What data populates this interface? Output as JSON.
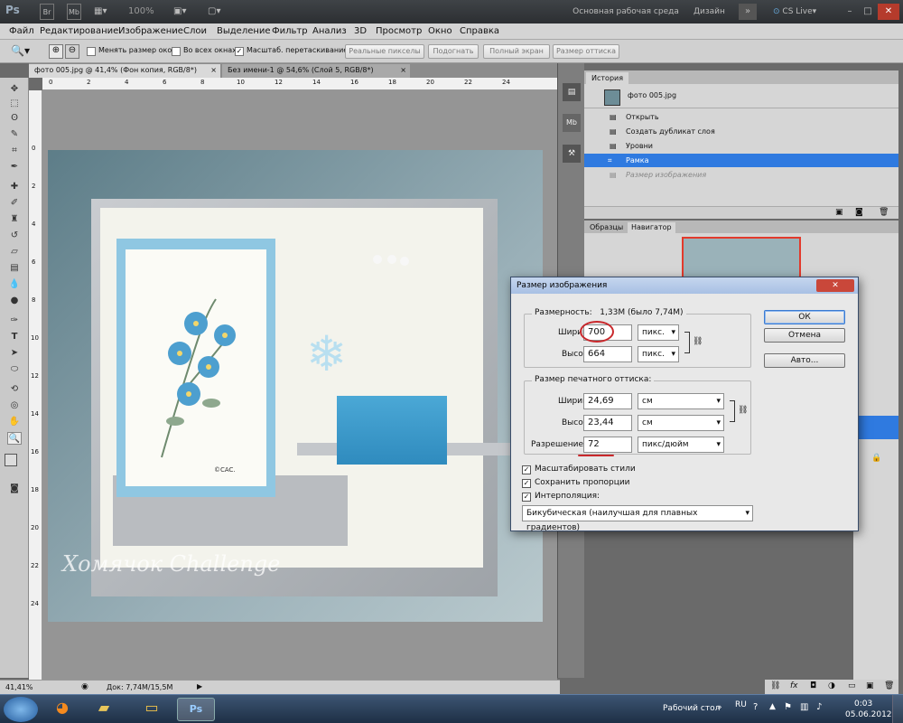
{
  "app": {
    "logo": "Ps",
    "zoom": "100%"
  },
  "workspace": {
    "basic": "Основная рабочая среда",
    "design": "Дизайн",
    "cs_live": "CS Live"
  },
  "menu": [
    "Файл",
    "Редактирование",
    "Изображение",
    "Слои",
    "Выделение",
    "Фильтр",
    "Анализ",
    "3D",
    "Просмотр",
    "Окно",
    "Справка"
  ],
  "options": {
    "resize_windows": "Менять размер окон",
    "all_windows": "Во всех окнах",
    "scrubby_zoom": "Масштаб. перетаскиванием",
    "actual_pixels": "Реальные пикселы",
    "fit": "Подогнать",
    "full_screen": "Полный экран",
    "print_size": "Размер оттиска"
  },
  "tabs": [
    {
      "label": "фото 005.jpg @ 41,4% (Фон копия, RGB/8*)",
      "close": "×"
    },
    {
      "label": "Без имени-1 @ 54,6% (Слой 5, RGB/8*)",
      "close": "×"
    }
  ],
  "ruler_ticks": [
    "0",
    "2",
    "4",
    "6",
    "8",
    "10",
    "12",
    "14",
    "16",
    "18",
    "20",
    "22",
    "24"
  ],
  "ruler_v": [
    "0",
    "2",
    "4",
    "6",
    "8",
    "10",
    "12",
    "14",
    "16",
    "18",
    "20",
    "22",
    "24"
  ],
  "watermark": "Хомячок Challenge",
  "card_signature": "©CAC.",
  "status": {
    "zoom": "41,41%",
    "doc": "Док: 7,74М/15,5М"
  },
  "history": {
    "tab": "История",
    "snapshot": "фото 005.jpg",
    "items": [
      "Открыть",
      "Создать дубликат слоя",
      "Уровни",
      "Рамка",
      "Размер изображения"
    ]
  },
  "navigator": {
    "tab_swatches": "Образцы",
    "tab_navigator": "Навигатор"
  },
  "dialog": {
    "title": "Размер изображения",
    "pixel_dims_label": "Размерность:",
    "pixel_dims_value": "1,33М (было 7,74М)",
    "width_label": "Ширина:",
    "width_value": "700",
    "width_unit": "пикс.",
    "height_label": "Высота:",
    "height_value": "664",
    "height_unit": "пикс.",
    "doc_size_title": "Размер печатного оттиска:",
    "doc_width_label": "Ширина:",
    "doc_width_value": "24,69",
    "doc_width_unit": "см",
    "doc_height_label": "Высота:",
    "doc_height_value": "23,44",
    "doc_height_unit": "см",
    "resolution_label": "Разрешение:",
    "resolution_value": "72",
    "resolution_unit": "пикс/дюйм",
    "scale_styles": "Масштабировать стили",
    "constrain": "Сохранить пропорции",
    "resample": "Интерполяция:",
    "resample_method": "Бикубическая (наилучшая для плавных градиентов)",
    "ok": "ОК",
    "cancel": "Отмена",
    "auto": "Авто..."
  },
  "taskbar": {
    "desktop": "Рабочий стол",
    "lang": "RU",
    "time": "0:03",
    "date": "05.06.2012"
  }
}
